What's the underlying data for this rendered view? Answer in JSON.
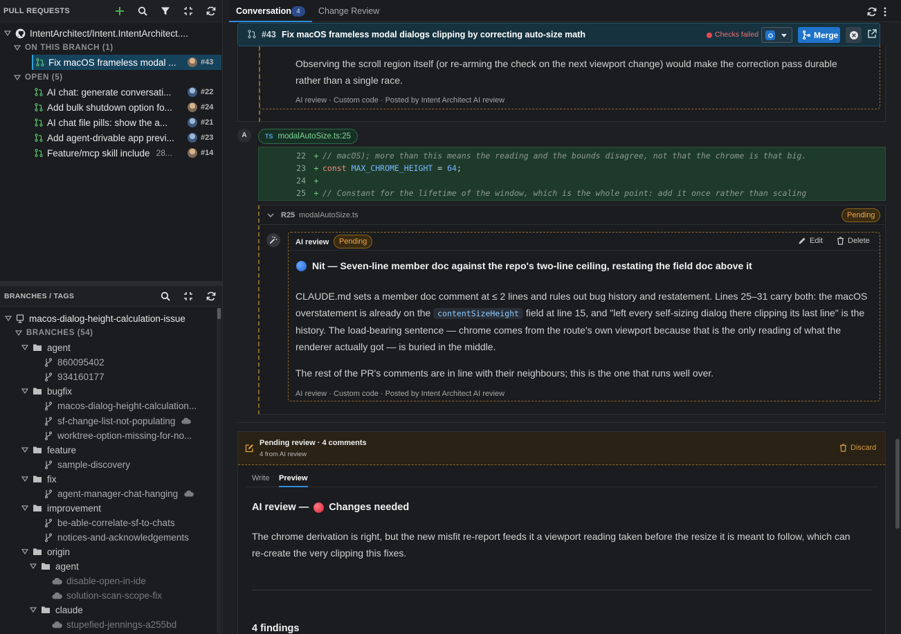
{
  "sidebar": {
    "pr_header": {
      "title": "PULL REQUESTS"
    },
    "repo": {
      "name": "IntentArchitect/Intent.IntentArchitect...."
    },
    "on_branch": {
      "label": "ON THIS BRANCH (1)"
    },
    "current_pr": {
      "title": "Fix macOS frameless modal ...",
      "number": "#43"
    },
    "open": {
      "label": "OPEN (5)"
    },
    "open_prs": [
      {
        "title": "AI chat: generate conversati...",
        "number": "#22"
      },
      {
        "title": "Add bulk shutdown option fo...",
        "number": "#24"
      },
      {
        "title": "AI chat file pills: show the a...",
        "number": "#21"
      },
      {
        "title": "Add agent-drivable app previ...",
        "number": "#23"
      },
      {
        "title": "Feature/mcp skill include",
        "extra": "28...",
        "number": "#14"
      }
    ],
    "branches_header": {
      "title": "BRANCHES / TAGS"
    },
    "current_branch": "macos-dialog-height-calculation-issue",
    "branches_label": "BRANCHES (54)",
    "tree": {
      "agent": "agent",
      "agent_b1": "860095402",
      "agent_b2": "934160177",
      "bugfix": "bugfix",
      "bugfix_b1": "macos-dialog-height-calculation...",
      "bugfix_b2": "sf-change-list-not-populating",
      "bugfix_b3": "worktree-option-missing-for-no...",
      "feature": "feature",
      "feature_b1": "sample-discovery",
      "fix": "fix",
      "fix_b1": "agent-manager-chat-hanging",
      "improvement": "improvement",
      "improvement_b1": "be-able-correlate-sf-to-chats",
      "improvement_b2": "notices-and-acknowledgements",
      "origin": "origin",
      "origin_agent": "agent",
      "origin_agent_b1": "disable-open-in-ide",
      "origin_agent_b2": "solution-scan-scope-fix",
      "origin_claude": "claude",
      "origin_claude_b1": "stupefied-jennings-a255bd"
    }
  },
  "tabs": {
    "conversation": "Conversation",
    "conversation_count": "4",
    "change_review": "Change Review"
  },
  "pr": {
    "number": "#43",
    "title": "Fix macOS frameless modal dialogs clipping by correcting auto-size math",
    "checks": "Checks failed",
    "merge": "Merge",
    "accent": "#1f73c9",
    "fail_color": "#e5484d"
  },
  "first_comment": {
    "text": "Observing the scroll region itself (or re-arming the check on the next viewport change) would make the correction pass durable rather than a single race.",
    "footer": "AI review · Custom code · Posted by Intent Architect AI review"
  },
  "thread": {
    "author_initial": "A",
    "file_chip": "modalAutoSize.ts:25",
    "file_icon": "TS",
    "code": [
      {
        "n": "22",
        "text": "// macOS); more than this means the reading and the bounds disagree, not that the chrome is that big."
      },
      {
        "n": "23",
        "kw": "const",
        "ident": "MAX_CHROME_HEIGHT",
        "op": " = ",
        "num": "64",
        "end": ";"
      },
      {
        "n": "24",
        "text": ""
      },
      {
        "n": "25",
        "text": "// Constant for the lifetime of the window, which is the whole point: add it once rather than scaling"
      }
    ],
    "plus": "+",
    "review_line": "R25",
    "review_file": "modalAutoSize.ts",
    "pending": "Pending"
  },
  "ai_comment": {
    "author": "AI review",
    "badge": "Pending",
    "edit": "Edit",
    "delete": "Delete",
    "heading": "Nit — Seven-line member doc against the repo's two-line ceiling, restating the field doc above it",
    "p1_a": "CLAUDE.md sets a member doc comment at ≤ 2 lines and rules out bug history and restatement. Lines 25–31 carry both: the macOS overstatement is already on the",
    "p1_code": "contentSizeHeight",
    "p1_b": "field at line 15, and \"left every self-sizing dialog there clipping its last line\" is the history. The load-bearing sentence — chrome comes from the route's own viewport because that is the only reading of what the renderer actually got — is buried in the middle.",
    "p2": "The rest of the PR's comments are in line with their neighbours; this is the one that runs well over.",
    "footer": "AI review · Custom code · Posted by Intent Architect AI review"
  },
  "pending_review": {
    "title": "Pending review · 4 comments",
    "subtitle": "4 from AI review",
    "discard": "Discard",
    "tab_write": "Write",
    "tab_preview": "Preview",
    "heading_a": "AI review —",
    "heading_b": "Changes needed",
    "body": "The chrome derivation is right, but the new misfit re-report feeds it a viewport reading taken before the resize it is meant to follow, which can re-create the very clipping this fixes.",
    "findings": "4 findings"
  }
}
